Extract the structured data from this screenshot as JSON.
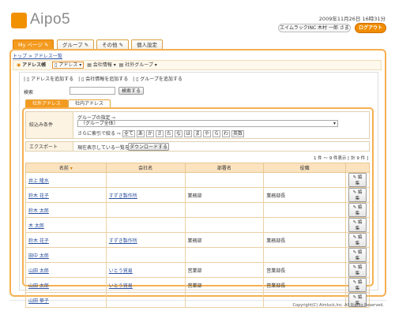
{
  "header": {
    "logo_text": "Aipo5",
    "date": "2009年11月26日 16時31分",
    "user": "エイムラックINC 木村 一郎 さま",
    "logout": "ログアウト"
  },
  "tabs": [
    "My ページ",
    "グループ",
    "その他",
    "個人設定"
  ],
  "breadcrumb": "トップ > アドレス一覧",
  "section": {
    "title": "アドレス帳",
    "items": [
      "アドレス",
      "会社情報",
      "社外グループ"
    ]
  },
  "actions": [
    "アドレスを追加する",
    "会社情報を追加する",
    "グループを追加する"
  ],
  "search": {
    "label": "検索",
    "button": "検索する"
  },
  "subtabs": [
    "社外アドレス",
    "社内アドレス"
  ],
  "filter": {
    "label": "絞込み条件",
    "group_title": "グループの指定",
    "group_value": "（グループ全体）",
    "index_prefix": "さらに索引で絞る",
    "index_letters": [
      "全て",
      "あ",
      "か",
      "さ",
      "た",
      "な",
      "は",
      "ま",
      "や",
      "ら",
      "わ",
      "英数"
    ]
  },
  "export": {
    "label": "エクスポート",
    "text": "現在表示している一覧を",
    "button": "ダウンロードする"
  },
  "count": "1 件 〜 9 件表示 [ 計 9 件 ]",
  "table": {
    "headers": [
      "名前",
      "会社名",
      "部署名",
      "役職",
      ""
    ],
    "rows": [
      {
        "name": "井上 隆水",
        "company": "",
        "dept": "",
        "title": ""
      },
      {
        "name": "鈴木 花子",
        "company": "すずき製作所",
        "dept": "業務部",
        "title": "業務部長"
      },
      {
        "name": "鈴木 太郎",
        "company": "",
        "dept": "",
        "title": ""
      },
      {
        "name": "木 太郎",
        "company": "",
        "dept": "",
        "title": ""
      },
      {
        "name": "鈴木 花子",
        "company": "すずき製作所",
        "dept": "業務部",
        "title": "業務部長"
      },
      {
        "name": "田中 太郎",
        "company": "",
        "dept": "",
        "title": ""
      },
      {
        "name": "山田 太郎",
        "company": "いとう貿易",
        "dept": "営業部",
        "title": "営業部長"
      },
      {
        "name": "山田 太郎",
        "company": "いとう貿易",
        "dept": "営業部",
        "title": "営業部長"
      },
      {
        "name": "山田 華子",
        "company": "",
        "dept": "",
        "title": ""
      }
    ],
    "edit_label": "編集"
  },
  "footer": "Copyright(C) Aimluck,Inc. All Rights Reserved."
}
